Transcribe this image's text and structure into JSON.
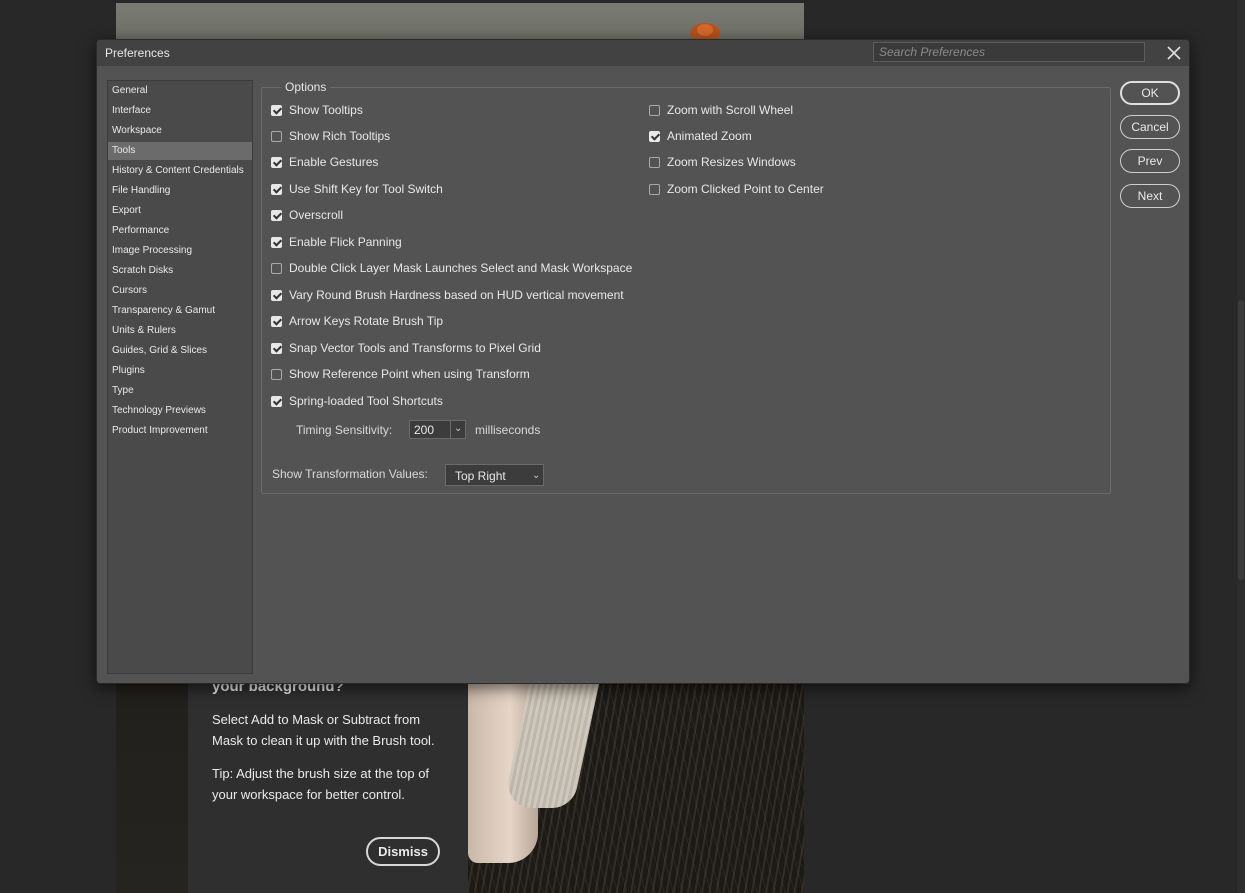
{
  "background": {
    "tip": {
      "heading": "your background?",
      "line1": "Select Add to Mask or Subtract from Mask to clean it up with the Brush tool.",
      "line2": "Tip: Adjust the brush size at the top of your workspace for better control.",
      "dismiss_label": "Dismiss"
    }
  },
  "dialog": {
    "title": "Preferences",
    "search_placeholder": "Search Preferences",
    "sidebar": [
      {
        "label": "General",
        "selected": false
      },
      {
        "label": "Interface",
        "selected": false
      },
      {
        "label": "Workspace",
        "selected": false
      },
      {
        "label": "Tools",
        "selected": true
      },
      {
        "label": "History & Content Credentials",
        "selected": false
      },
      {
        "label": "File Handling",
        "selected": false
      },
      {
        "label": "Export",
        "selected": false
      },
      {
        "label": "Performance",
        "selected": false
      },
      {
        "label": "Image Processing",
        "selected": false
      },
      {
        "label": "Scratch Disks",
        "selected": false
      },
      {
        "label": "Cursors",
        "selected": false
      },
      {
        "label": "Transparency & Gamut",
        "selected": false
      },
      {
        "label": "Units & Rulers",
        "selected": false
      },
      {
        "label": "Guides, Grid & Slices",
        "selected": false
      },
      {
        "label": "Plugins",
        "selected": false
      },
      {
        "label": "Type",
        "selected": false
      },
      {
        "label": "Technology Previews",
        "selected": false
      },
      {
        "label": "Product Improvement",
        "selected": false
      }
    ],
    "options": {
      "legend": "Options",
      "left": [
        {
          "label": "Show Tooltips",
          "checked": true
        },
        {
          "label": "Show Rich Tooltips",
          "checked": false
        },
        {
          "label": "Enable Gestures",
          "checked": true
        },
        {
          "label": "Use Shift Key for Tool Switch",
          "checked": true
        },
        {
          "label": "Overscroll",
          "checked": true
        },
        {
          "label": "Enable Flick Panning",
          "checked": true
        },
        {
          "label": "Double Click Layer Mask Launches Select and Mask Workspace",
          "checked": false
        },
        {
          "label": "Vary Round Brush Hardness based on HUD vertical movement",
          "checked": true
        },
        {
          "label": "Arrow Keys Rotate Brush Tip",
          "checked": true
        },
        {
          "label": "Snap Vector Tools and Transforms to Pixel Grid",
          "checked": true
        },
        {
          "label": "Show Reference Point when using Transform",
          "checked": false
        },
        {
          "label": "Spring-loaded Tool Shortcuts",
          "checked": true
        }
      ],
      "right": [
        {
          "label": "Zoom with Scroll Wheel",
          "checked": false
        },
        {
          "label": "Animated Zoom",
          "checked": true
        },
        {
          "label": "Zoom Resizes Windows",
          "checked": false
        },
        {
          "label": "Zoom Clicked Point to Center",
          "checked": false
        }
      ],
      "timing_label": "Timing Sensitivity:",
      "timing_value": "200",
      "timing_unit": "milliseconds",
      "transform_label": "Show Transformation Values:",
      "transform_value": "Top Right"
    },
    "buttons": {
      "ok": "OK",
      "cancel": "Cancel",
      "prev": "Prev",
      "next": "Next"
    }
  }
}
